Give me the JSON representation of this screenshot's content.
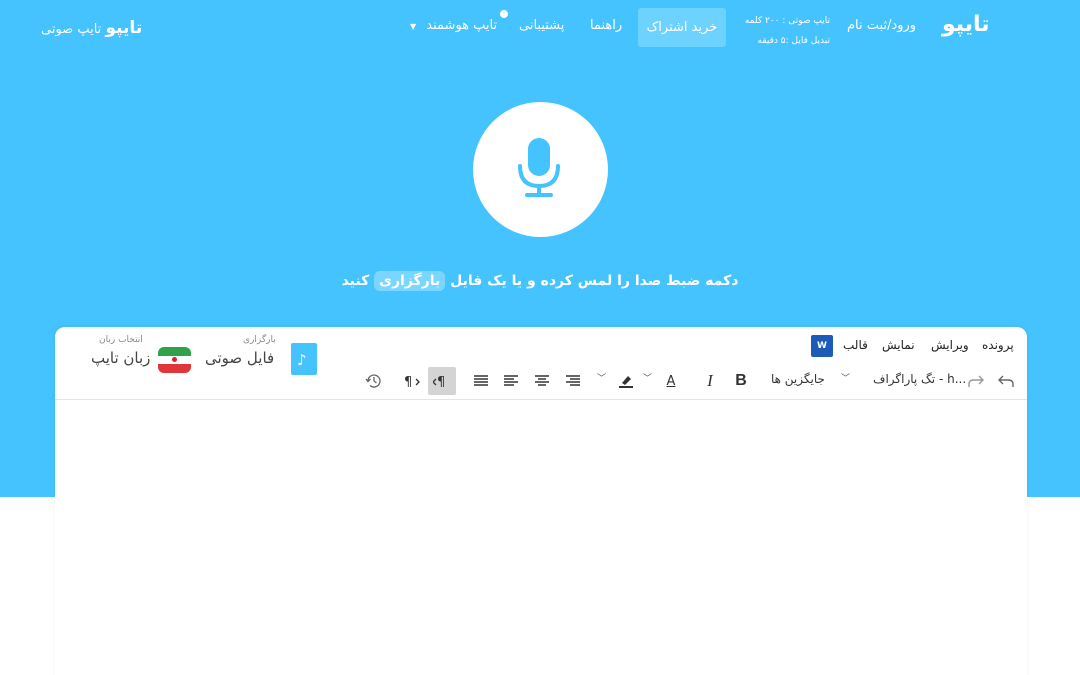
{
  "nav": {
    "logo": "تایپو",
    "login": "ورود/ثبت نام",
    "plan_line1": "تایپ صوتی : ۲۰۰ کلمه",
    "plan_line2": "تبدیل فایل :۵ دقیقه",
    "buy": "خرید اشتراک",
    "help": "راهنما",
    "support": "پشتیبانی",
    "smart": "تایپ هوشمند",
    "brand_left_bold": "تایپو",
    "brand_left_text": "تایپ صوتی"
  },
  "hero": {
    "instruction_pre": "دکمه ضبط صدا را لمس کرده و یا یک فایل",
    "instruction_highlight": "بارگزاری",
    "instruction_post": "کنید"
  },
  "editor": {
    "menus": [
      "پرونده",
      "ویرایش",
      "نمایش",
      "قالب"
    ],
    "word_icon": "W",
    "paragraph_tag": "تگ پاراگراف - h...",
    "replacements": "جایگزین ها",
    "bold": "B",
    "italic": "I",
    "font_color": "A"
  },
  "upload": {
    "caption": "بارگزاری",
    "label": "فایل صوتی"
  },
  "language": {
    "caption": "انتخاب زبان",
    "label": "زبان تایپ"
  },
  "colors": {
    "hero_bg": "#44c3ff",
    "buy_bg": "#6ed2ff",
    "mic": "#44c3ff"
  }
}
